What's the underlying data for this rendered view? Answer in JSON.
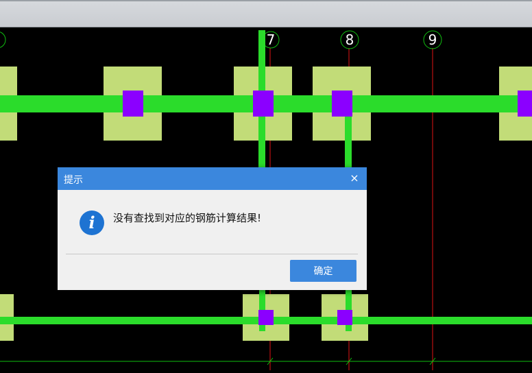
{
  "axes": {
    "labels": [
      "7",
      "8",
      "9"
    ]
  },
  "dialog": {
    "title": "提示",
    "close_glyph": "×",
    "icon": "info-icon",
    "message": "没有查找到对应的钢筋计算结果!",
    "ok_label": "确定"
  },
  "colors": {
    "background": "#000000",
    "beam": "#2bdc2b",
    "pad": "#c2dc78",
    "column": "#8b00ff",
    "axis_line": "#e11515",
    "axis_circle": "#10c010",
    "dialog_accent": "#3b87dd"
  }
}
